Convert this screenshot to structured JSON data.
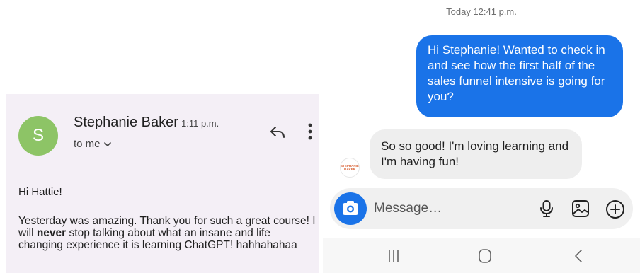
{
  "email": {
    "avatar_initial": "S",
    "sender_name": "Stephanie Baker",
    "time": "1:11 p.m.",
    "recipient": "to me",
    "greeting": "Hi Hattie!",
    "body_part1": "Yesterday was amazing. Thank you for such a great course!   I will ",
    "body_bold": "never",
    "body_part2": " stop talking about what an insane and life changing experience it is learning ChatGPT! hahhahahaa",
    "icons": [
      "reply-icon",
      "more-vert-icon",
      "chevron-down-icon"
    ],
    "colors": {
      "panel_bg": "#f4eff6",
      "avatar_bg": "#8dc466"
    }
  },
  "chat": {
    "timestamp": "Today 12:41 p.m.",
    "outgoing_message": "Hi Stephanie! Wanted to check in and see how the first half of the sales funnel intensive is going for you?",
    "incoming_message": "So so good!  I'm loving learning and I'm having fun!",
    "contact_avatar_text": "STEPHANIE BAKER",
    "composer": {
      "placeholder": "Message…"
    },
    "icons": [
      "camera-icon",
      "microphone-icon",
      "gallery-icon",
      "add-circle-icon"
    ],
    "nav_icons": [
      "recents-icon",
      "home-icon",
      "back-icon"
    ],
    "colors": {
      "outgoing_bubble": "#1a73e8",
      "incoming_bubble": "#eeeeee"
    }
  }
}
